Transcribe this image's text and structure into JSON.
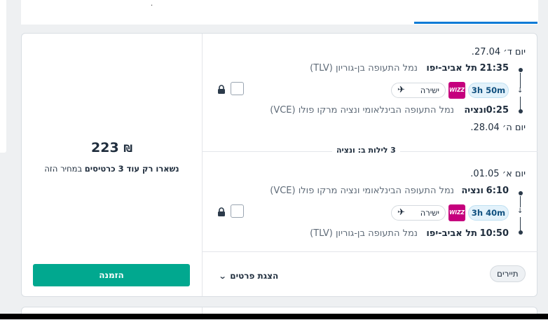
{
  "top_tabs": {
    "dot": "."
  },
  "offer": {
    "price_currency": "₪",
    "price_value": "223",
    "seats_bold": "נשארו רק עוד 3 כרטיסים",
    "seats_rest": "במחיר הזה",
    "book_label": "הזמנה",
    "details_label": "הצגת פרטים",
    "tourists_label": "תיירים",
    "nights_label": "3 לילות ב: ונציה"
  },
  "outbound": {
    "date_dep": "יום ד׳ 27.04.",
    "dep_time": "21:35",
    "dep_city": "תל אביב-יפו",
    "dep_airport": "נמל התעופה בן-גוריון (TLV)",
    "duration": "3h 50m",
    "airline": "WIZZ",
    "stops": "ישירה",
    "arr_time": "0:25",
    "arr_city": "ונציה",
    "arr_airport": "נמל התעופה הבינלאומי ונציה מרקו פולו (VCE)",
    "date_arr": "יום ה׳ 28.04."
  },
  "inbound": {
    "date_dep": "יום א׳ 01.05.",
    "dep_time": "6:10",
    "dep_city": "ונציה",
    "dep_airport": "נמל התעופה הבינלאומי ונציה מרקו פולו (VCE)",
    "duration": "3h 40m",
    "airline": "WIZZ",
    "stops": "ישירה",
    "arr_time": "10:50",
    "arr_city": "תל אביב-יפו",
    "arr_airport": "נמל התעופה בן-גוריון (TLV)"
  },
  "colors": {
    "accent_button": "#01a88f",
    "tab_active": "#0a7ad6",
    "airline_brand": "#c5007d",
    "duration_bg": "#e3f2fb"
  }
}
